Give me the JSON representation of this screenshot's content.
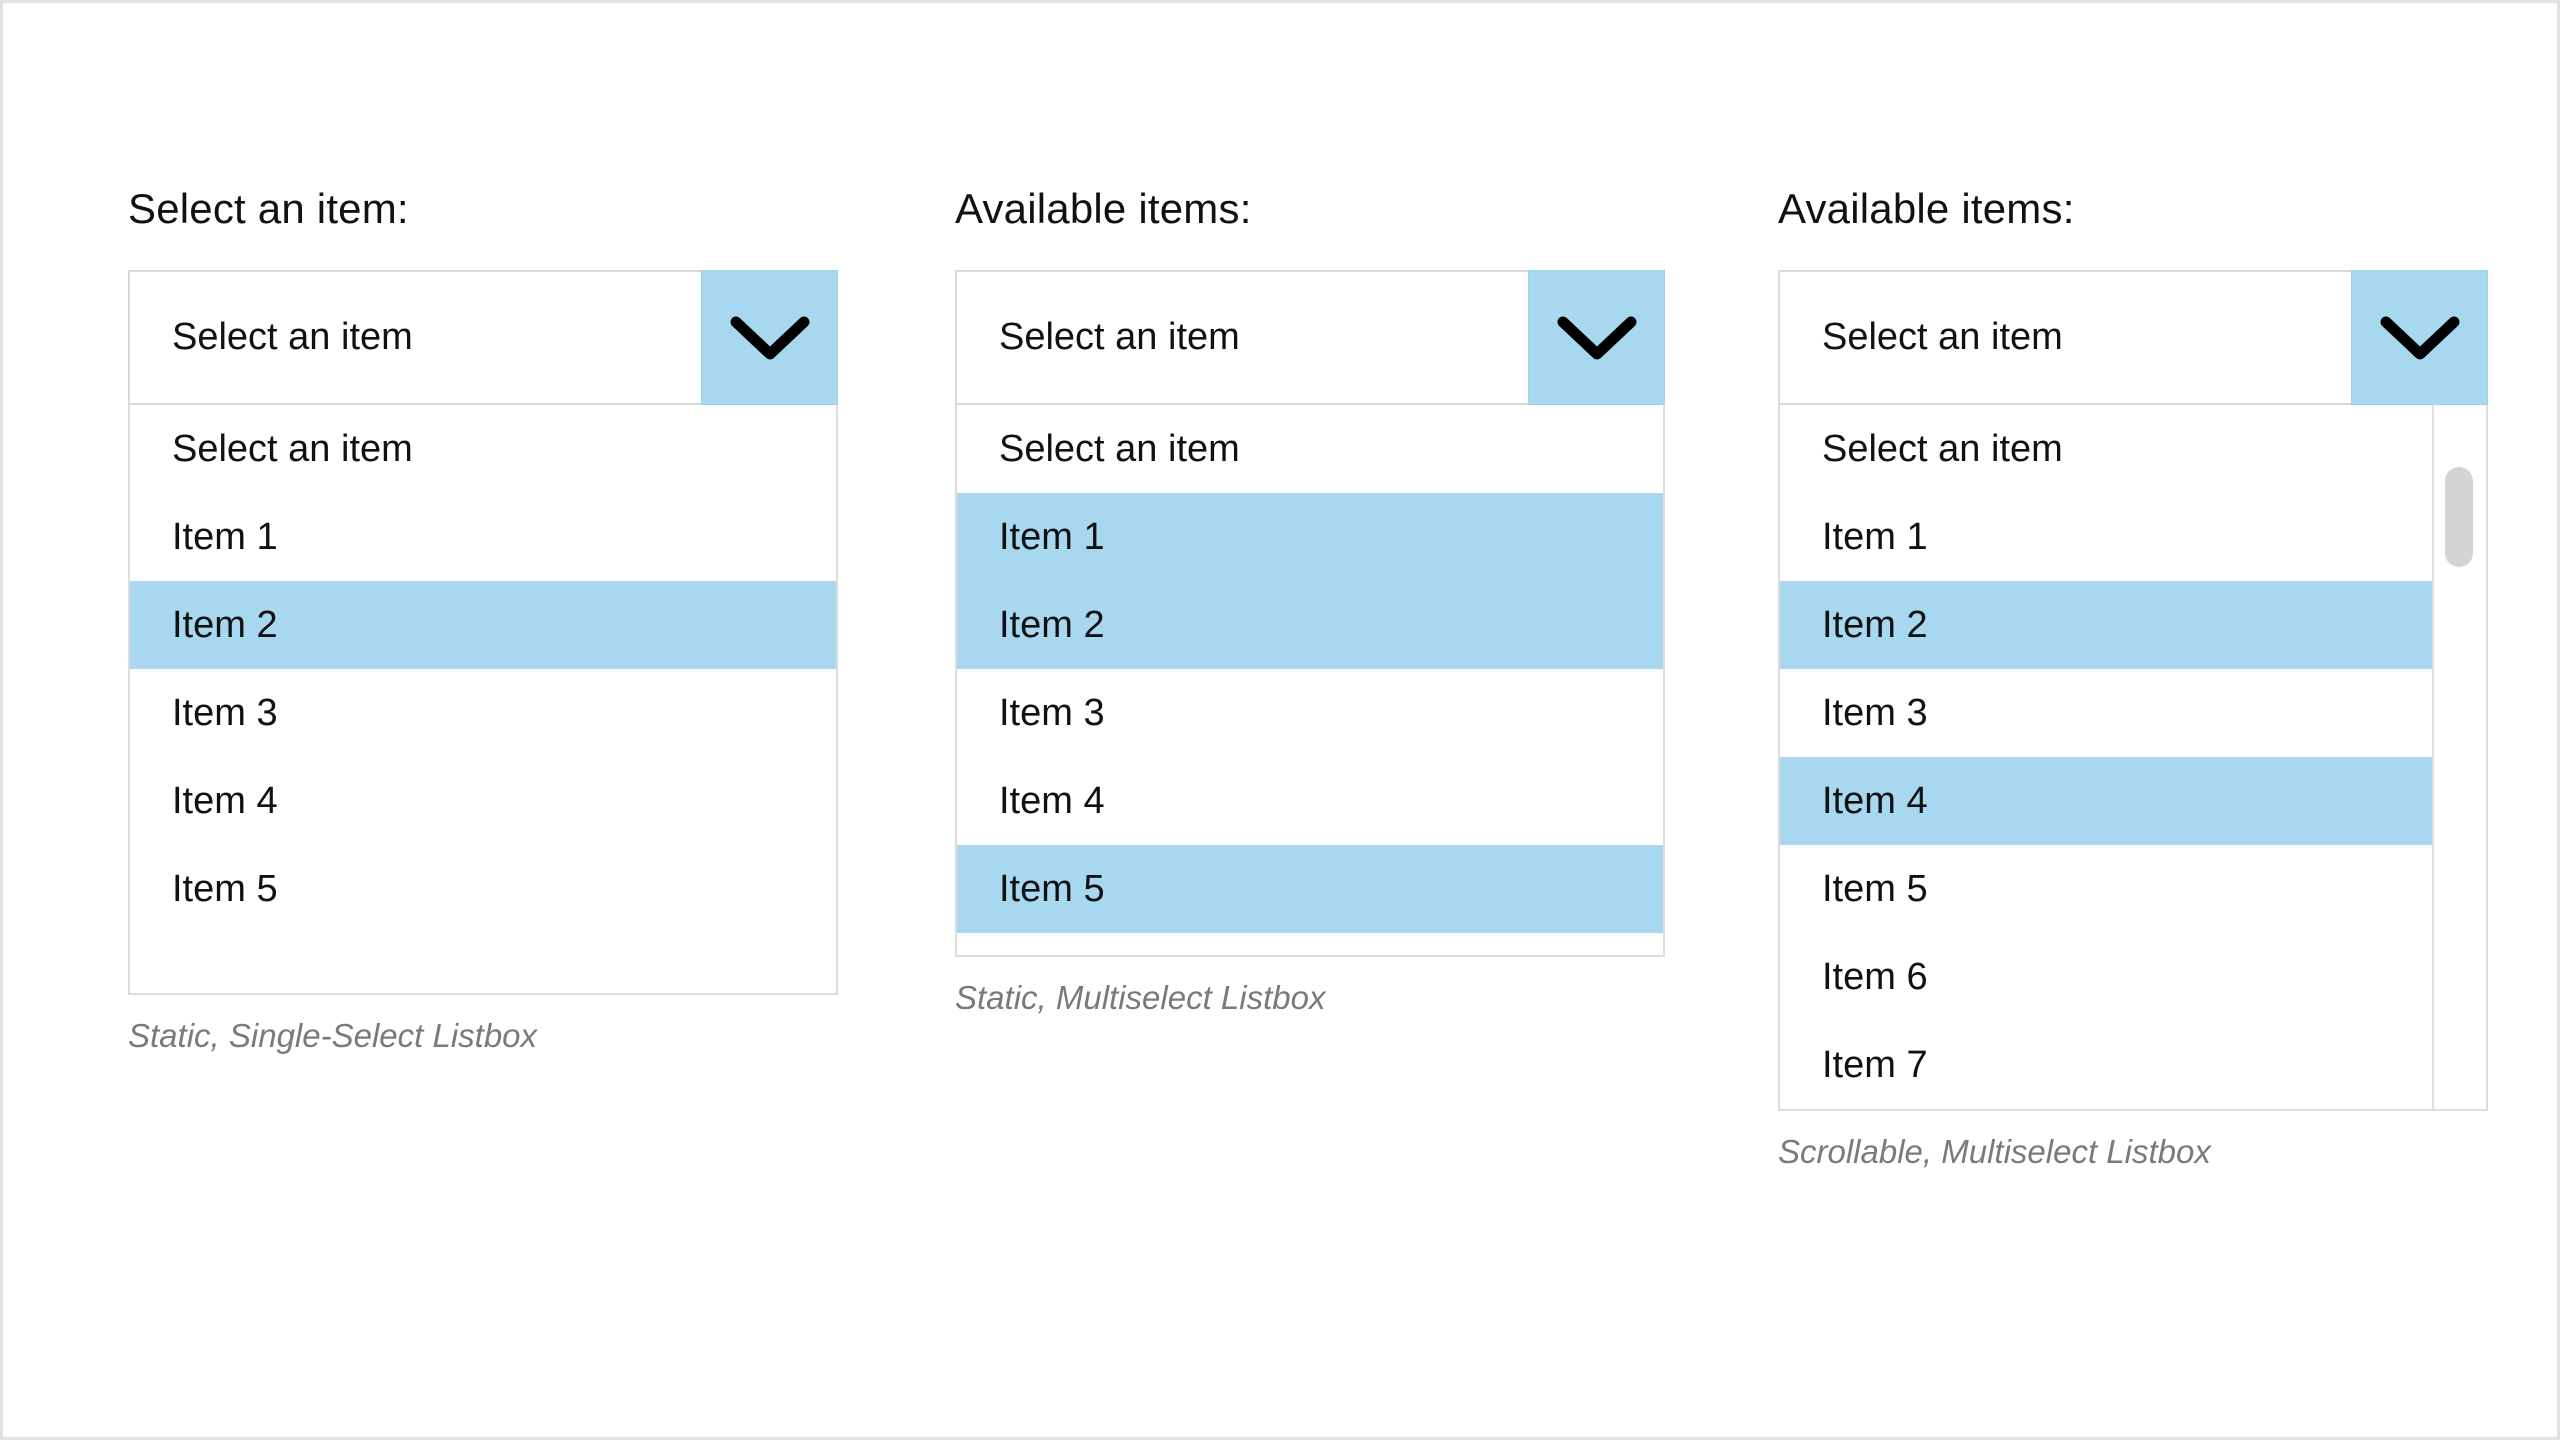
{
  "colors": {
    "accent_blue": "#a8d8f0",
    "border_gray": "#dcdcdc",
    "text_dark": "#111111",
    "caption_gray": "#7a7a7a",
    "scroll_thumb": "#d4d4d4"
  },
  "columns": [
    {
      "label": "Select an item:",
      "combobox_value": "Select an item",
      "arrow_icon": "chevron-down-icon",
      "options": [
        {
          "label": "Select an item",
          "selected": false
        },
        {
          "label": "Item 1",
          "selected": false
        },
        {
          "label": "Item 2",
          "selected": true
        },
        {
          "label": "Item 3",
          "selected": false
        },
        {
          "label": "Item 4",
          "selected": false
        },
        {
          "label": "Item 5",
          "selected": false
        }
      ],
      "caption": "Static, Single-Select Listbox",
      "scrollable": false
    },
    {
      "label": "Available items:",
      "combobox_value": "Select an item",
      "arrow_icon": "chevron-down-icon",
      "options": [
        {
          "label": "Select an item",
          "selected": false
        },
        {
          "label": "Item 1",
          "selected": true
        },
        {
          "label": "Item 2",
          "selected": true
        },
        {
          "label": "Item 3",
          "selected": false
        },
        {
          "label": "Item 4",
          "selected": false
        },
        {
          "label": "Item 5",
          "selected": true
        }
      ],
      "caption": "Static, Multiselect Listbox",
      "scrollable": false
    },
    {
      "label": "Available items:",
      "combobox_value": "Select an item",
      "arrow_icon": "chevron-down-icon",
      "options": [
        {
          "label": "Select an item",
          "selected": false
        },
        {
          "label": "Item 1",
          "selected": false
        },
        {
          "label": "Item 2",
          "selected": true
        },
        {
          "label": "Item 3",
          "selected": false
        },
        {
          "label": "Item 4",
          "selected": true
        },
        {
          "label": "Item 5",
          "selected": false
        },
        {
          "label": "Item 6",
          "selected": false
        },
        {
          "label": "Item 7",
          "selected": false
        }
      ],
      "caption": "Scrollable, Multiselect Listbox",
      "scrollable": true
    }
  ]
}
